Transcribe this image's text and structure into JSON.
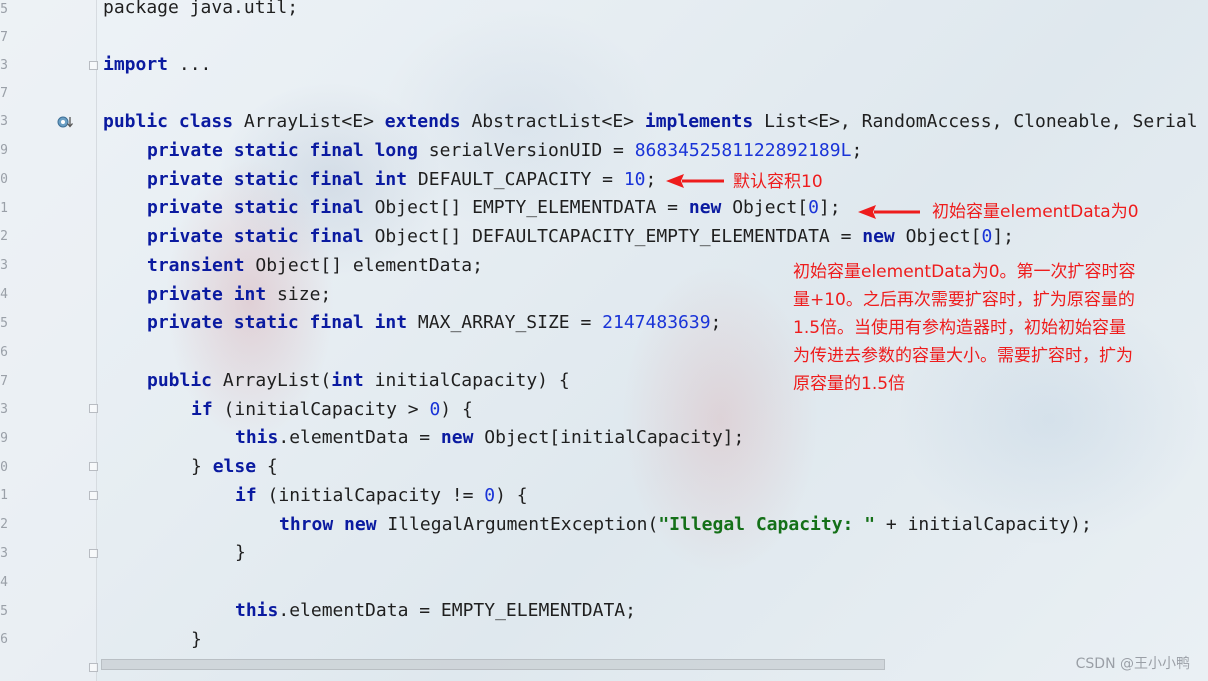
{
  "gutter": {
    "line_numbers": [
      "5",
      "7",
      "3",
      "7",
      "3",
      "9",
      "0",
      "1",
      "2",
      "3",
      "4",
      "5",
      "6",
      "7",
      "3",
      "9",
      "0",
      "1",
      "2",
      "3",
      "4",
      "5",
      "6"
    ]
  },
  "code": {
    "line_package": "package java.util;",
    "line_import_kw": "import",
    "line_import_rest": " ...",
    "class_decl": {
      "kw1": "public class",
      "name": " ArrayList<E> ",
      "kw2": "extends",
      "parent": " AbstractList<E> ",
      "kw3": "implements",
      "ifaces": " List<E>, RandomAccess, Cloneable, Serial"
    },
    "serial": {
      "kw": "private static final long",
      "name": " serialVersionUID = ",
      "val": "8683452581122892189L",
      "end": ";"
    },
    "default_capacity": {
      "kw": "private static final int",
      "name": " DEFAULT_CAPACITY = ",
      "val": "10",
      "end": ";"
    },
    "empty_elementdata": {
      "kw": "private static final",
      "name": " Object[] EMPTY_ELEMENTDATA = ",
      "kw2": "new",
      "obj": " Object[",
      "val": "0",
      "end": "];"
    },
    "default_empty": {
      "kw": "private static final",
      "name": " Object[] DEFAULTCAPACITY_EMPTY_ELEMENTDATA = ",
      "kw2": "new",
      "obj": " Object[",
      "val": "0",
      "end": "];"
    },
    "transient_line": {
      "kw": "transient",
      "rest": " Object[] elementData;"
    },
    "size_line": {
      "kw": "private int",
      "rest": " size;"
    },
    "max_size": {
      "kw": "private static final int",
      "name": " MAX_ARRAY_SIZE = ",
      "val": "2147483639",
      "end": ";"
    },
    "ctor": {
      "kw": "public",
      "name": " ArrayList(",
      "kw2": "int",
      "rest": " initialCapacity) {"
    },
    "if1": {
      "kw": "if",
      "rest": " (initialCapacity > ",
      "val": "0",
      "end": ") {"
    },
    "assign1": {
      "kw": "this",
      "rest": ".elementData = ",
      "kw2": "new",
      "end": " Object[initialCapacity];"
    },
    "else_line": {
      "pre": "} ",
      "kw": "else",
      "end": " {"
    },
    "if2": {
      "kw": "if",
      "rest": " (initialCapacity != ",
      "val": "0",
      "end": ") {"
    },
    "throw_line": {
      "kw": "throw new",
      "rest": " IllegalArgumentException(",
      "str": "\"Illegal Capacity: \"",
      "end": " + initialCapacity);"
    },
    "close1": "}",
    "assign2": {
      "kw": "this",
      "rest": ".elementData = EMPTY_ELEMENTDATA;"
    },
    "close2": "}"
  },
  "annotations": {
    "default_capacity_note": "默认容积10",
    "empty_note": "初始容量elementData为0",
    "block_note_lines": [
      "初始容量elementData为0。第一次扩容时容",
      "量+10。之后再次需要扩容时，扩为原容量的",
      "1.5倍。当使用有参构造器时，初始初始容量",
      "为传进去参数的容量大小。需要扩容时，扩为",
      "原容量的1.5倍"
    ],
    "color": "#ee1c1c"
  },
  "watermark": "CSDN @王小小鸭"
}
